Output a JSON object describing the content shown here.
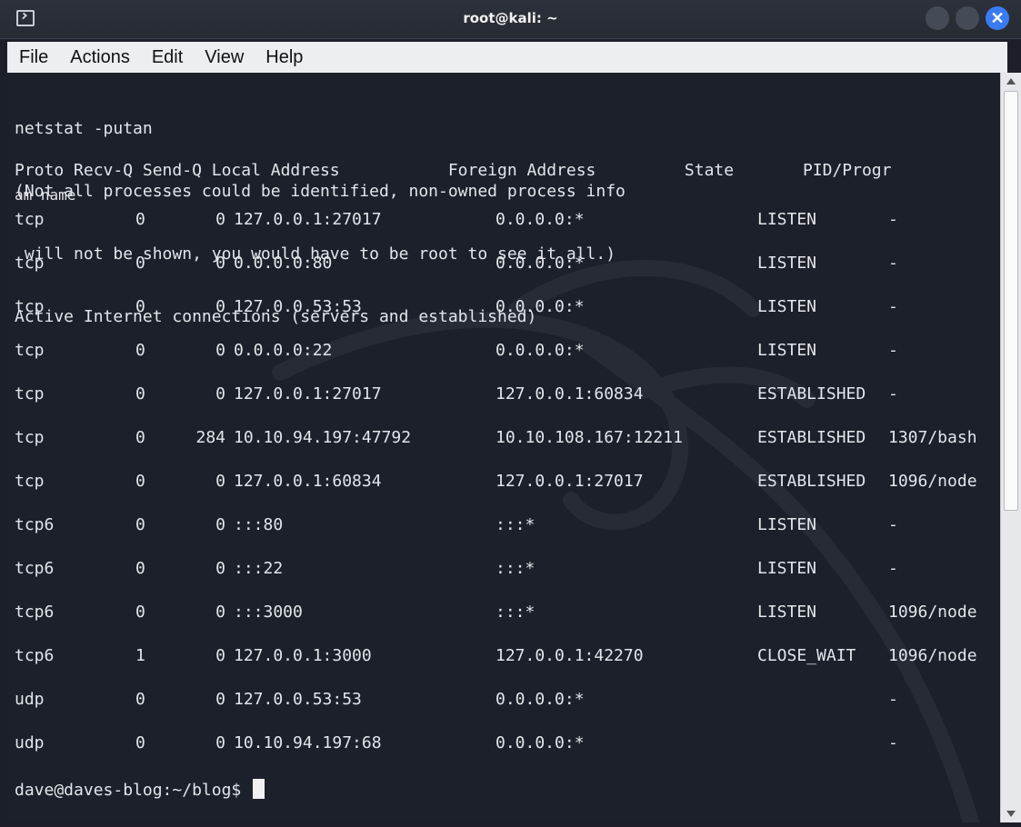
{
  "window": {
    "title": "root@kali: ~"
  },
  "menu": [
    "File",
    "Actions",
    "Edit",
    "View",
    "Help"
  ],
  "terminal": {
    "pre_lines": [
      "netstat -putan",
      "(Not all processes could be identified, non-owned process info",
      " will not be shown, you would have to be root to see it all.)",
      "Active Internet connections (servers and established)"
    ],
    "header": "Proto Recv-Q Send-Q Local Address           Foreign Address         State       PID/Progr",
    "header_wrap": "am name",
    "rows": [
      {
        "proto": "tcp",
        "recv_q": "0",
        "send_q": "0",
        "local": "127.0.0.1:27017",
        "foreign": "0.0.0.0:*",
        "state": "LISTEN",
        "pid": "-"
      },
      {
        "proto": "tcp",
        "recv_q": "0",
        "send_q": "0",
        "local": "0.0.0.0:80",
        "foreign": "0.0.0.0:*",
        "state": "LISTEN",
        "pid": "-"
      },
      {
        "proto": "tcp",
        "recv_q": "0",
        "send_q": "0",
        "local": "127.0.0.53:53",
        "foreign": "0.0.0.0:*",
        "state": "LISTEN",
        "pid": "-"
      },
      {
        "proto": "tcp",
        "recv_q": "0",
        "send_q": "0",
        "local": "0.0.0.0:22",
        "foreign": "0.0.0.0:*",
        "state": "LISTEN",
        "pid": "-"
      },
      {
        "proto": "tcp",
        "recv_q": "0",
        "send_q": "0",
        "local": "127.0.0.1:27017",
        "foreign": "127.0.0.1:60834",
        "state": "ESTABLISHED",
        "pid": "-"
      },
      {
        "proto": "tcp",
        "recv_q": "0",
        "send_q": "284",
        "local": "10.10.94.197:47792",
        "foreign": "10.10.108.167:12211",
        "state": "ESTABLISHED",
        "pid": "1307/bash"
      },
      {
        "proto": "tcp",
        "recv_q": "0",
        "send_q": "0",
        "local": "127.0.0.1:60834",
        "foreign": "127.0.0.1:27017",
        "state": "ESTABLISHED",
        "pid": "1096/node"
      },
      {
        "proto": "tcp6",
        "recv_q": "0",
        "send_q": "0",
        "local": ":::80",
        "foreign": ":::*",
        "state": "LISTEN",
        "pid": "-"
      },
      {
        "proto": "tcp6",
        "recv_q": "0",
        "send_q": "0",
        "local": ":::22",
        "foreign": ":::*",
        "state": "LISTEN",
        "pid": "-"
      },
      {
        "proto": "tcp6",
        "recv_q": "0",
        "send_q": "0",
        "local": ":::3000",
        "foreign": ":::*",
        "state": "LISTEN",
        "pid": "1096/node"
      },
      {
        "proto": "tcp6",
        "recv_q": "1",
        "send_q": "0",
        "local": "127.0.0.1:3000",
        "foreign": "127.0.0.1:42270",
        "state": "CLOSE_WAIT",
        "pid": "1096/node"
      },
      {
        "proto": "udp",
        "recv_q": "0",
        "send_q": "0",
        "local": "127.0.0.53:53",
        "foreign": "0.0.0.0:*",
        "state": "",
        "pid": "-"
      },
      {
        "proto": "udp",
        "recv_q": "0",
        "send_q": "0",
        "local": "10.10.94.197:68",
        "foreign": "0.0.0.0:*",
        "state": "",
        "pid": "-"
      }
    ],
    "prompt": "dave@daves-blog:~/blog$ "
  },
  "icons": {
    "app": "terminal-icon",
    "minimize": "minimize-icon",
    "maximize": "maximize-icon",
    "close": "close-icon"
  },
  "colors": {
    "terminal_bg": "#1c202a",
    "text": "#e3e5ea",
    "close_button": "#3a7bf2"
  }
}
